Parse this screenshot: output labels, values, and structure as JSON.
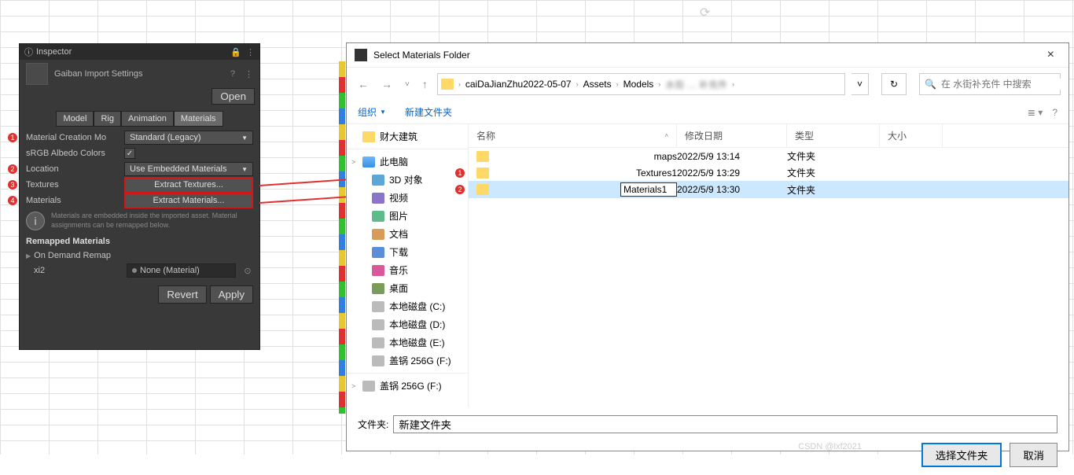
{
  "inspector": {
    "title": "Inspector",
    "asset_name": "Gaiban Import Settings",
    "open_btn": "Open",
    "tabs": [
      "Model",
      "Rig",
      "Animation",
      "Materials"
    ],
    "active_tab": 3,
    "fields": {
      "creation_mode_label": "Material Creation Mo",
      "creation_mode_value": "Standard (Legacy)",
      "srgb_label": "sRGB Albedo Colors",
      "srgb_checked": true,
      "location_label": "Location",
      "location_value": "Use Embedded Materials",
      "textures_label": "Textures",
      "textures_btn": "Extract Textures...",
      "materials_label": "Materials",
      "materials_btn": "Extract Materials..."
    },
    "info_text": "Materials are embedded inside the imported asset. Material assignments can be remapped below.",
    "remapped_title": "Remapped Materials",
    "on_demand_label": "On Demand Remap",
    "material_entry": {
      "name": "xi2",
      "value": "None (Material)"
    },
    "revert_btn": "Revert",
    "apply_btn": "Apply",
    "annots": [
      "1",
      "2",
      "3",
      "4"
    ]
  },
  "dialog": {
    "title": "Select Materials Folder",
    "breadcrumb": [
      "caiDaJianZhu2022-05-07",
      "Assets",
      "Models"
    ],
    "search_placeholder": "在 水街补充件 中搜索",
    "toolbar": {
      "organize": "组织",
      "new_folder": "新建文件夹"
    },
    "columns": {
      "name": "名称",
      "date": "修改日期",
      "type": "类型",
      "size": "大小"
    },
    "tree": [
      {
        "label": "财大建筑",
        "icon": "folder"
      },
      {
        "sep": true
      },
      {
        "label": "此电脑",
        "icon": "pc",
        "exp": true
      },
      {
        "label": "3D 对象",
        "icon": "3d",
        "indent": true
      },
      {
        "label": "视频",
        "icon": "video",
        "indent": true
      },
      {
        "label": "图片",
        "icon": "pic",
        "indent": true
      },
      {
        "label": "文档",
        "icon": "doc",
        "indent": true
      },
      {
        "label": "下载",
        "icon": "dl",
        "indent": true
      },
      {
        "label": "音乐",
        "icon": "music",
        "indent": true
      },
      {
        "label": "桌面",
        "icon": "desk",
        "indent": true
      },
      {
        "label": "本地磁盘 (C:)",
        "icon": "drive",
        "indent": true
      },
      {
        "label": "本地磁盘 (D:)",
        "icon": "drive",
        "indent": true
      },
      {
        "label": "本地磁盘 (E:)",
        "icon": "drive",
        "indent": true
      },
      {
        "label": "盖锅 256G (F:)",
        "icon": "drive",
        "indent": true
      },
      {
        "sep": true
      },
      {
        "label": "盖锅 256G (F:)",
        "icon": "drive",
        "exp": true
      }
    ],
    "rows": [
      {
        "name": "maps",
        "date": "2022/5/9 13:14",
        "type": "文件夹",
        "annot": null
      },
      {
        "name": "Textures1",
        "date": "2022/5/9 13:29",
        "type": "文件夹",
        "annot": "1"
      },
      {
        "name": "Materials1",
        "date": "2022/5/9 13:30",
        "type": "文件夹",
        "annot": "2",
        "selected": true,
        "rename": true
      }
    ],
    "footer": {
      "folder_label": "文件夹:",
      "folder_value": "新建文件夹",
      "select_btn": "选择文件夹",
      "cancel_btn": "取消"
    }
  },
  "watermark": "CSDN @lxf2021"
}
